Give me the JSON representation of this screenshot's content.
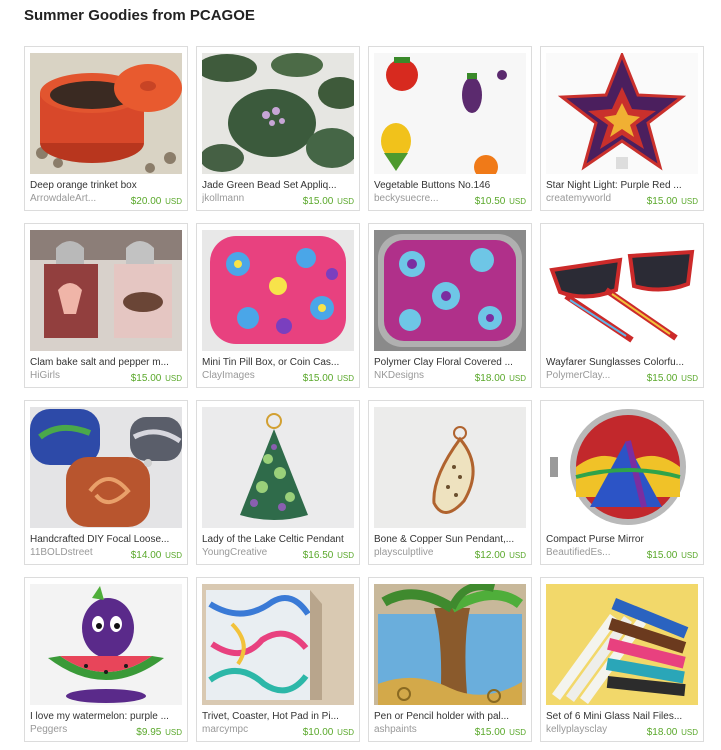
{
  "page": {
    "title": "Summer Goodies from PCAGOE"
  },
  "currency": "USD",
  "items": [
    {
      "title": "Deep orange trinket box",
      "shop": "ArrowdaleArt...",
      "price": "$20.00",
      "icon": "trinket-box-image"
    },
    {
      "title": "Jade Green Bead Set Appliq...",
      "shop": "jkollmann",
      "price": "$15.00",
      "icon": "green-beads-image"
    },
    {
      "title": "Vegetable Buttons No.146",
      "shop": "beckysuecre...",
      "price": "$10.50",
      "icon": "vegetable-buttons-image"
    },
    {
      "title": "Star Night Light: Purple Red ...",
      "shop": "createmyworld",
      "price": "$15.00",
      "icon": "star-night-light-image"
    },
    {
      "title": "Clam bake salt and pepper m...",
      "shop": "HiGirls",
      "price": "$15.00",
      "icon": "salt-pepper-shakers-image"
    },
    {
      "title": "Mini Tin Pill Box, or Coin Cas...",
      "shop": "ClayImages",
      "price": "$15.00",
      "icon": "pill-box-image"
    },
    {
      "title": "Polymer Clay Floral Covered ...",
      "shop": "NKDesigns",
      "price": "$18.00",
      "icon": "floral-compact-image"
    },
    {
      "title": "Wayfarer Sunglasses Colorfu...",
      "shop": "PolymerClay...",
      "price": "$15.00",
      "icon": "sunglasses-image"
    },
    {
      "title": "Handcrafted DIY Focal Loose...",
      "shop": "11BOLDstreet",
      "price": "$14.00",
      "icon": "focal-beads-image"
    },
    {
      "title": "Lady of the Lake Celtic Pendant",
      "shop": "YoungCreative",
      "price": "$16.50",
      "icon": "celtic-pendant-image"
    },
    {
      "title": "Bone & Copper Sun Pendant,...",
      "shop": "playsculptlive",
      "price": "$12.00",
      "icon": "copper-pendant-image"
    },
    {
      "title": "Compact Purse Mirror",
      "shop": "BeautifiedEs...",
      "price": "$15.00",
      "icon": "purse-mirror-image"
    },
    {
      "title": "I love my watermelon: purple ...",
      "shop": "Peggers",
      "price": "$9.95",
      "icon": "watermelon-figure-image"
    },
    {
      "title": "Trivet, Coaster, Hot Pad in Pi...",
      "shop": "marcympc",
      "price": "$10.00",
      "icon": "trivet-image"
    },
    {
      "title": "Pen or Pencil holder with pal...",
      "shop": "ashpaints",
      "price": "$15.00",
      "icon": "pencil-holder-image"
    },
    {
      "title": "Set of 6 Mini Glass Nail Files...",
      "shop": "kellyplaysclay",
      "price": "$18.00",
      "icon": "nail-files-image"
    }
  ]
}
